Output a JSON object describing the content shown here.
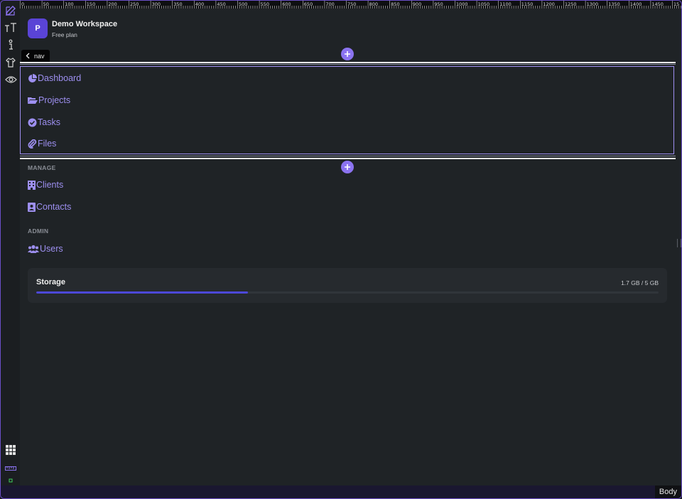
{
  "tools": [
    "pencil-edit-icon",
    "text-format-icon",
    "info-icon",
    "shirt-icon",
    "eye-icon"
  ],
  "bottom_tools": [
    "grid-icon",
    "ruler-icon",
    "status-dot-icon"
  ],
  "ruler": {
    "labels": [
      "0",
      "50",
      "100",
      "150",
      "200",
      "250",
      "300",
      "350",
      "400",
      "450",
      "500",
      "550",
      "600",
      "650",
      "700",
      "750",
      "800",
      "850",
      "900",
      "950",
      "1000",
      "1050",
      "1100",
      "1150",
      "1200",
      "1250",
      "1300",
      "1350",
      "1400",
      "1450",
      "15"
    ]
  },
  "workspace": {
    "avatar_letter": "P",
    "name": "Demo Workspace",
    "plan": "Free plan"
  },
  "nav_tag": {
    "label": "nav"
  },
  "nav": {
    "items": [
      {
        "label": "Dashboard",
        "icon": "pie-chart-icon"
      },
      {
        "label": "Projects",
        "icon": "folder-open-icon"
      },
      {
        "label": "Tasks",
        "icon": "check-circle-icon"
      },
      {
        "label": "Files",
        "icon": "paperclip-icon"
      }
    ]
  },
  "manage": {
    "heading": "MANAGE",
    "items": [
      {
        "label": "Clients",
        "icon": "building-icon"
      },
      {
        "label": "Contacts",
        "icon": "address-card-icon"
      }
    ]
  },
  "admin": {
    "heading": "ADMIN",
    "items": [
      {
        "label": "Users",
        "icon": "users-icon"
      }
    ]
  },
  "storage": {
    "title": "Storage",
    "value": "1.7 GB / 5 GB",
    "used_fraction": 0.34
  },
  "status": {
    "selected_element": "Body"
  },
  "colors": {
    "accent": "#8b73f0",
    "link": "#9d8ff0",
    "brand": "#5a44d6",
    "progress": "#4c48d8",
    "frame": "#6b4fc8"
  }
}
